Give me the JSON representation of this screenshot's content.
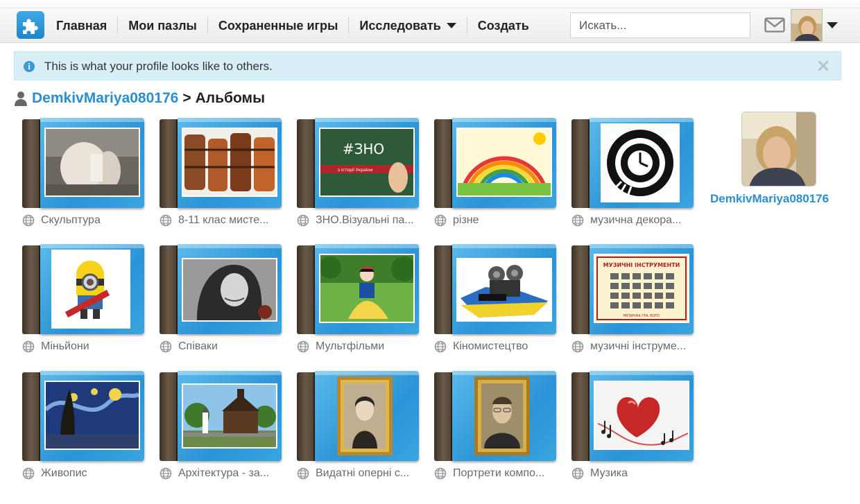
{
  "nav": {
    "items": [
      "Главная",
      "Мои пазлы",
      "Сохраненные игры",
      "Исследовать",
      "Создать"
    ],
    "search_placeholder": "Искать..."
  },
  "banner": {
    "text": "This is what your profile looks like to others.",
    "close": "×"
  },
  "heading": {
    "user": "DemkivMariya080176",
    "separator": ">",
    "page": "Альбомы"
  },
  "albums": [
    {
      "title": "Скульптура"
    },
    {
      "title": "8-11 клас мисте..."
    },
    {
      "title": "ЗНО.Візуальні па..."
    },
    {
      "title": "різне"
    },
    {
      "title": "музична декора..."
    },
    {
      "title": "Міньйони"
    },
    {
      "title": "Співаки"
    },
    {
      "title": "Мультфільми"
    },
    {
      "title": "Кіномистецтво"
    },
    {
      "title": "музичні інструме..."
    },
    {
      "title": "Живопис"
    },
    {
      "title": "Архітектура - за..."
    },
    {
      "title": "Видатні оперні с..."
    },
    {
      "title": "Портрети компо..."
    },
    {
      "title": "Музика"
    }
  ],
  "thumb_texts": {
    "zno_main": "#ЗНО",
    "zno_sub": "з історії України",
    "instruments_title": "МУЗИЧНІ ІНСТРУМЕНТИ",
    "instruments_sub": "МУЗИЧНА ГРА ЛОТО"
  },
  "profile": {
    "name": "DemkivMariya080176"
  },
  "colors": {
    "accent": "#2a8fd0",
    "banner_bg": "#d9eff8"
  }
}
